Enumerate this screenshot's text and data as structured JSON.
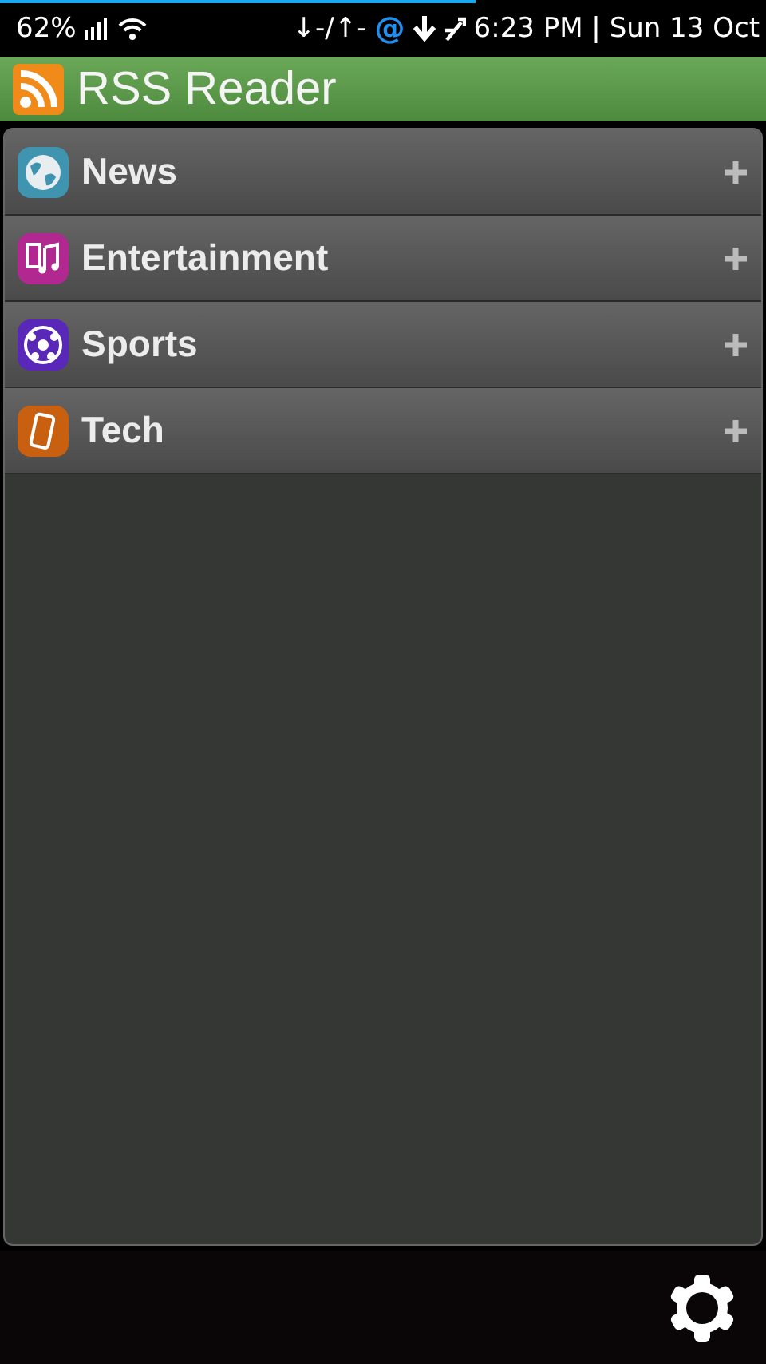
{
  "status_bar": {
    "progress": {
      "level": 0.62
    },
    "battery": "62%",
    "transfer": "↓-/↑-",
    "mail_glyph": "@",
    "clock": "6:23 PM | Sun 13 Oct"
  },
  "title_bar": {
    "title": "RSS Reader"
  },
  "categories": [
    {
      "label": "News",
      "kind": "globe"
    },
    {
      "label": "Entertainment",
      "kind": "music"
    },
    {
      "label": "Sports",
      "kind": "ball"
    },
    {
      "label": "Tech",
      "kind": "phone"
    }
  ]
}
